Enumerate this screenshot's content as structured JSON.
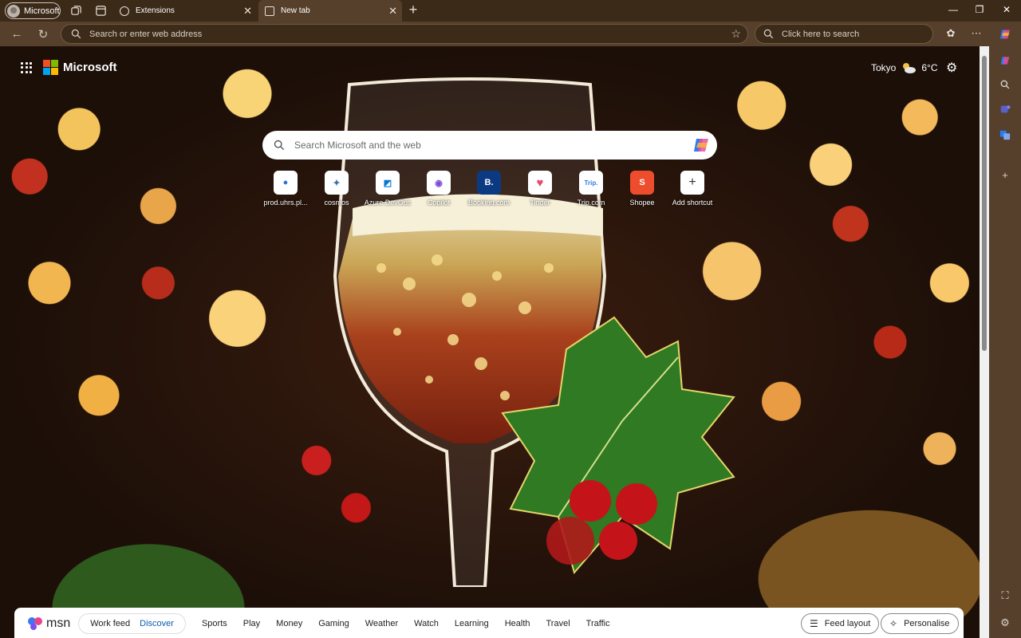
{
  "titlebar": {
    "profile_label": "Microsoft",
    "tabs": [
      {
        "label": "Extensions"
      },
      {
        "label": "New tab"
      }
    ]
  },
  "toolbar": {
    "address_placeholder": "Search or enter web address",
    "search_placeholder": "Click here to search"
  },
  "ntp": {
    "brand": "Microsoft",
    "weather": {
      "city": "Tokyo",
      "temp": "6°C"
    },
    "search_placeholder": "Search Microsoft and the web",
    "shortcuts": [
      {
        "label": "prod.uhrs.pl...",
        "glyph": "●",
        "color": "#2f6de1"
      },
      {
        "label": "cosmos",
        "glyph": "✦",
        "color": "#3a6ea8"
      },
      {
        "label": "Azure DevOps",
        "glyph": "◩",
        "color": "#0078d4"
      },
      {
        "label": "Copilot",
        "glyph": "◉",
        "color": "#7a4ad8"
      },
      {
        "label": "Booking.com",
        "glyph": "B.",
        "color": "#0b3a82"
      },
      {
        "label": "Tinder",
        "glyph": "♥",
        "color": "#e84a6f"
      },
      {
        "label": "Trip.com",
        "glyph": "Trip.",
        "color": "#2f7ae1"
      },
      {
        "label": "Shopee",
        "glyph": "S",
        "color": "#ee4d2d"
      },
      {
        "label": "Add shortcut",
        "glyph": "+",
        "color": "#333333"
      }
    ]
  },
  "feed": {
    "brand": "msn",
    "tabs": [
      {
        "label": "Work feed"
      },
      {
        "label": "Discover"
      }
    ],
    "categories": [
      "Sports",
      "Play",
      "Money",
      "Gaming",
      "Weather",
      "Watch",
      "Learning",
      "Health",
      "Travel",
      "Traffic"
    ],
    "feed_layout": "Feed layout",
    "personalise": "Personalise"
  }
}
